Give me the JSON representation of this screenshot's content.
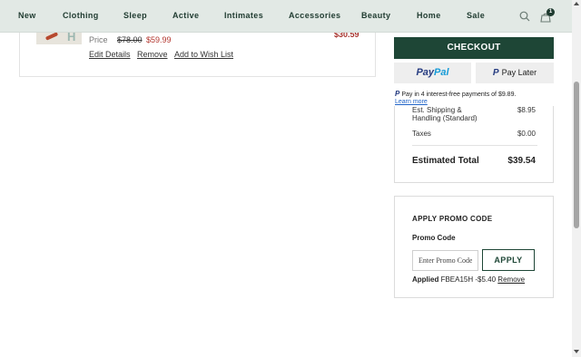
{
  "nav": {
    "items": [
      "New",
      "Clothing",
      "Sleep",
      "Active",
      "Intimates",
      "Accessories",
      "Beauty",
      "Home",
      "Sale"
    ],
    "bag_count": "1"
  },
  "cart_item": {
    "price_label": "Price",
    "original_price": "$78.00",
    "sale_price": "$59.99",
    "line_total": "$30.59",
    "links": {
      "edit": "Edit Details",
      "remove": "Remove",
      "wishlist": "Add to Wish List"
    }
  },
  "checkout": {
    "button_label": "CHECKOUT",
    "paypal_pay": "Pay",
    "paypal_pal": "Pal",
    "paylater_label": "Pay Later",
    "paypal_message": "Pay in 4 interest-free payments of $9.89.",
    "learn_more": "Learn more"
  },
  "summary": {
    "shipping_label": "Est. Shipping & Handling (Standard)",
    "shipping_value": "$8.95",
    "taxes_label": "Taxes",
    "taxes_value": "$0.00",
    "total_label": "Estimated Total",
    "total_value": "$39.54"
  },
  "promo": {
    "title": "APPLY PROMO CODE",
    "field_label": "Promo Code",
    "placeholder": "Enter Promo Code",
    "apply_label": "APPLY",
    "applied_label": "Applied",
    "applied_code": "FBEA15H -$5.40",
    "remove_label": "Remove"
  },
  "colors": {
    "brand_green": "#1e4636",
    "nav_bg": "#e2e9e5",
    "sale_red": "#b3362e"
  }
}
